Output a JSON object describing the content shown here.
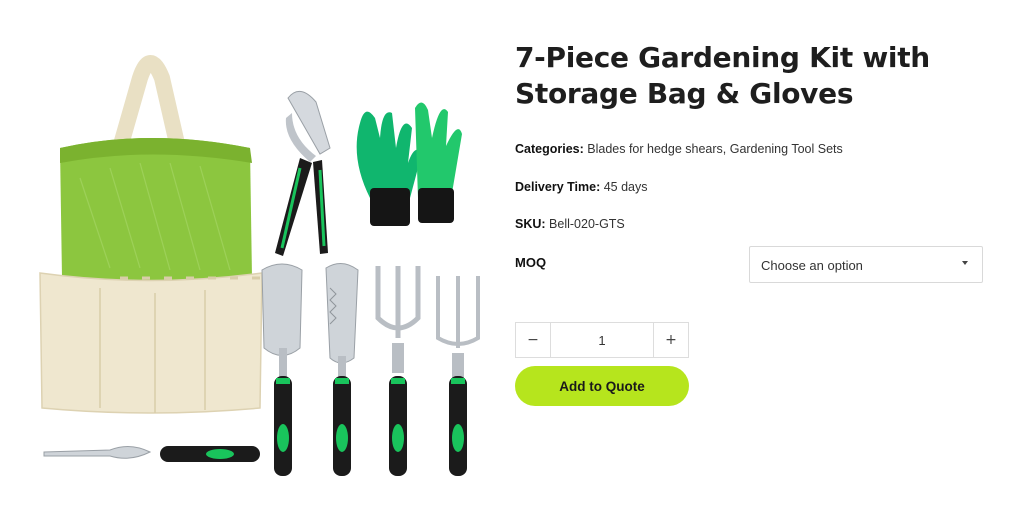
{
  "product": {
    "title_line1": "7-Piece Gardening Kit with",
    "title_line2": "Storage Bag & Gloves",
    "categories_label": "Categories:",
    "categories_value": "Blades for hedge shears, Gardening Tool Sets",
    "delivery_label": "Delivery Time:",
    "delivery_value": "45 days",
    "sku_label": "SKU:",
    "sku_value": "Bell-020-GTS"
  },
  "moq": {
    "label": "MOQ",
    "select_value": "Choose an option"
  },
  "quantity": {
    "minus_label": "−",
    "value": "1",
    "plus_label": "+"
  },
  "actions": {
    "add_to_quote_label": "Add to Quote"
  },
  "colors": {
    "accent": "#b6e51d",
    "bag_green": "#8cc63f",
    "bag_cream": "#efe7cf",
    "tool_green": "#19c45c"
  }
}
